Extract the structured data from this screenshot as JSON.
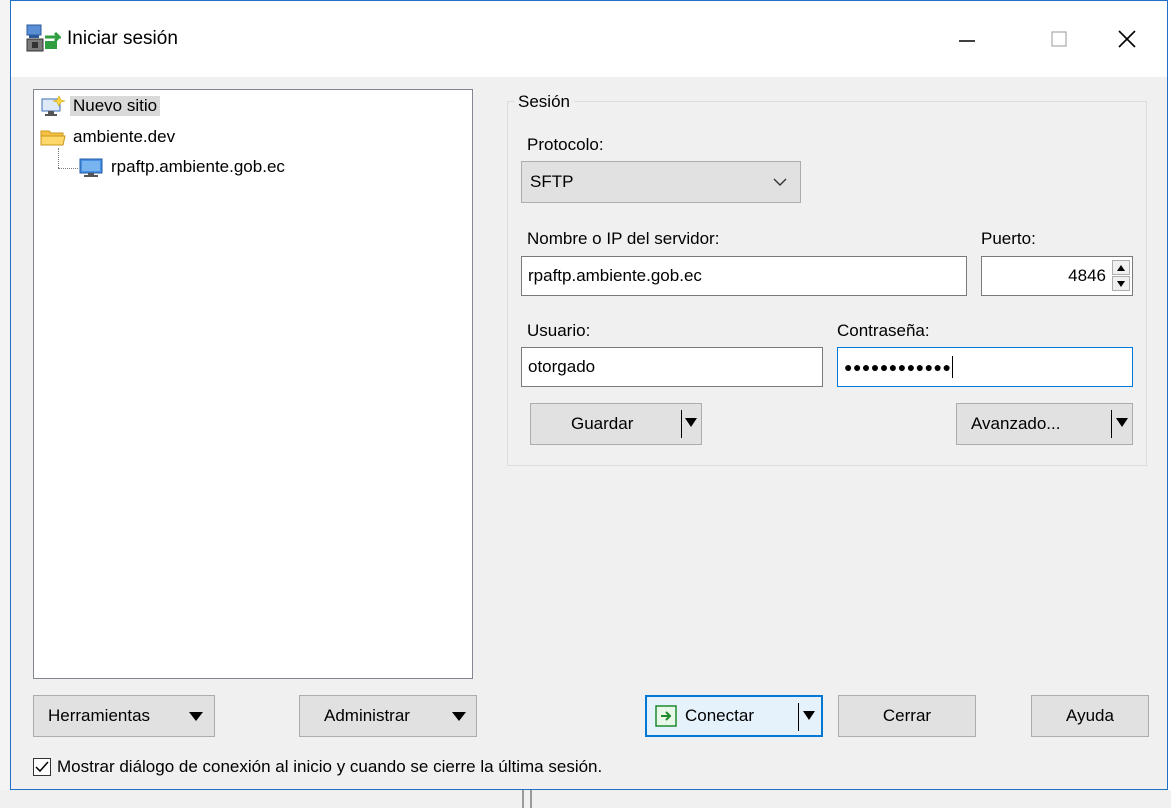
{
  "window": {
    "title": "Iniciar sesión"
  },
  "tree": {
    "items": [
      {
        "label": "Nuevo sitio"
      },
      {
        "label": "ambiente.dev"
      },
      {
        "label": "rpaftp.ambiente.gob.ec"
      }
    ]
  },
  "session": {
    "group_label": "Sesión",
    "protocol_label": "Protocolo:",
    "protocol_value": "SFTP",
    "host_label": "Nombre o IP del servidor:",
    "host_value": "rpaftp.ambiente.gob.ec",
    "port_label": "Puerto:",
    "port_value": "4846",
    "user_label": "Usuario:",
    "user_value": "otorgado",
    "password_label": "Contraseña:",
    "password_value": "●●●●●●●●●●●●",
    "save_label": "Guardar",
    "advanced_label": "Avanzado..."
  },
  "buttons": {
    "tools": "Herramientas",
    "manage": "Administrar",
    "connect": "Conectar",
    "close": "Cerrar",
    "help": "Ayuda"
  },
  "footer": {
    "show_dialog_label": "Mostrar diálogo de conexión al inicio y cuando se cierre la última sesión."
  },
  "colors": {
    "accent": "#0078d7",
    "folder": "#f6c142"
  }
}
